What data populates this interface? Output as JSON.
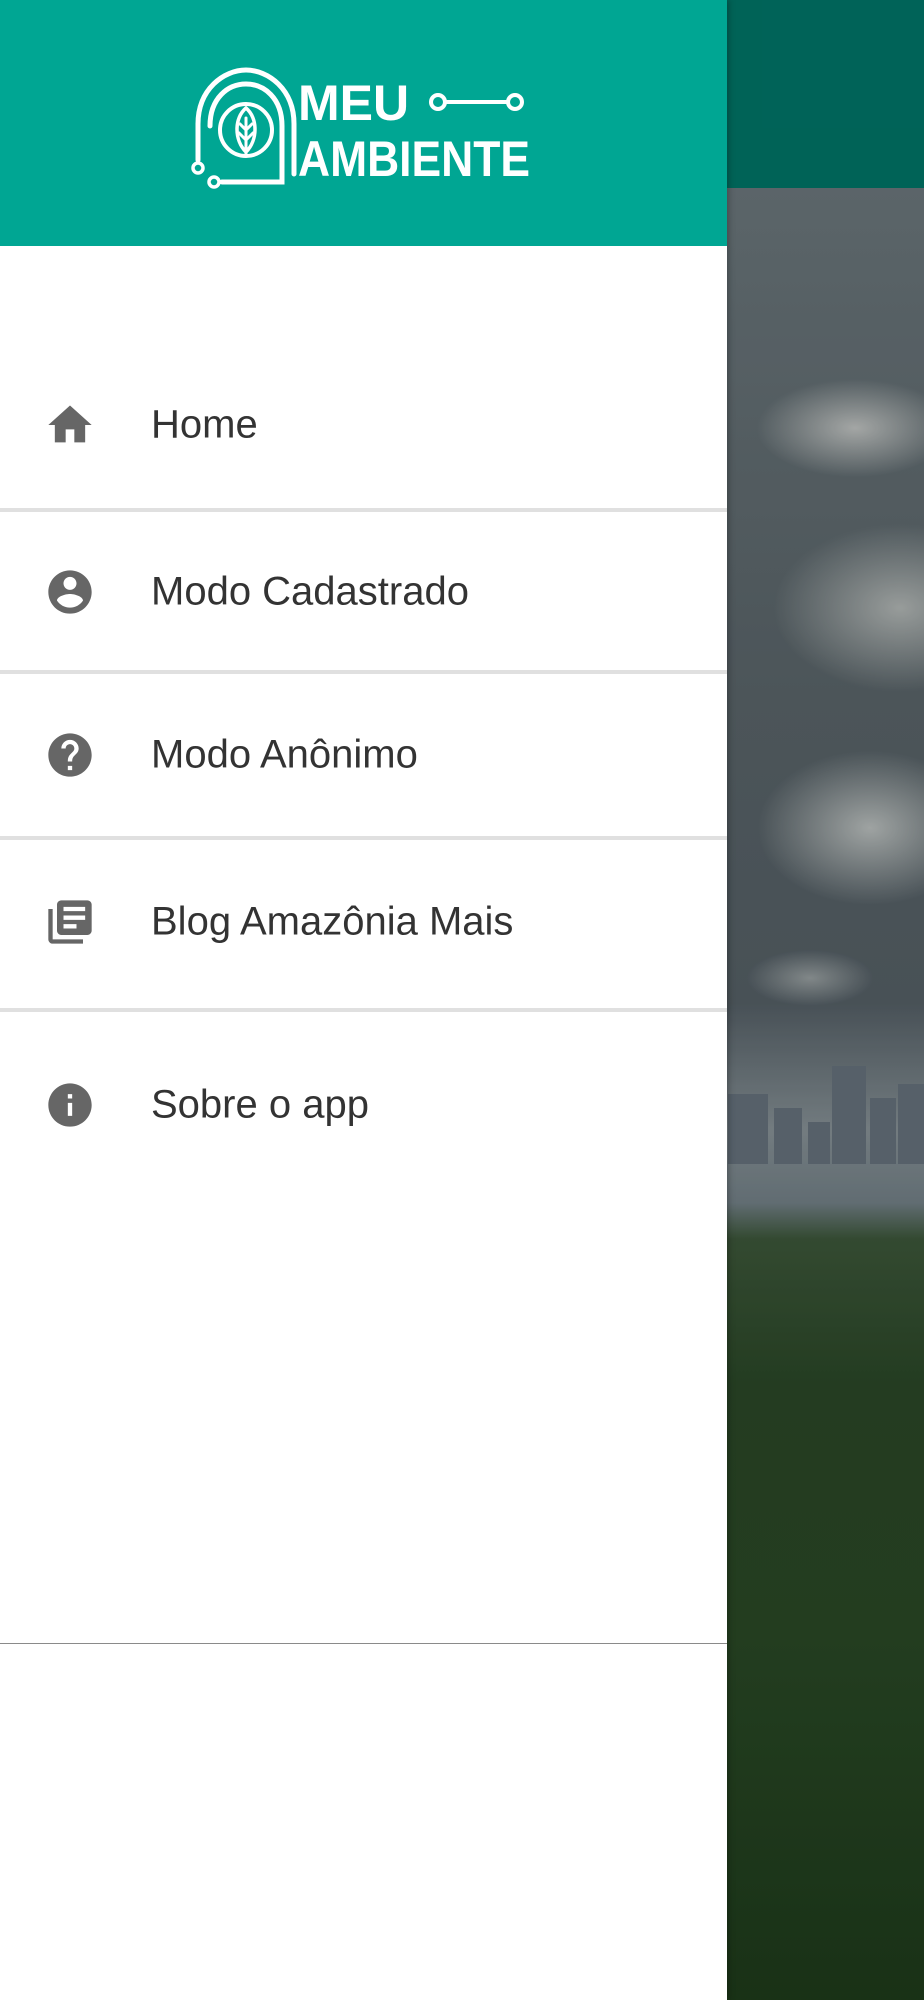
{
  "app": {
    "logo_line1": "MEU",
    "logo_line2": "AMBIENTE",
    "primary_color": "#00a693",
    "background_header_color": "#00796b"
  },
  "drawer": {
    "items": [
      {
        "label": "Home",
        "icon": "home-icon"
      },
      {
        "label": "Modo Cadastrado",
        "icon": "account-circle-icon"
      },
      {
        "label": "Modo Anônimo",
        "icon": "help-circle-icon"
      },
      {
        "label": "Blog Amazônia Mais",
        "icon": "library-books-icon"
      },
      {
        "label": "Sobre o app",
        "icon": "info-icon"
      }
    ]
  }
}
